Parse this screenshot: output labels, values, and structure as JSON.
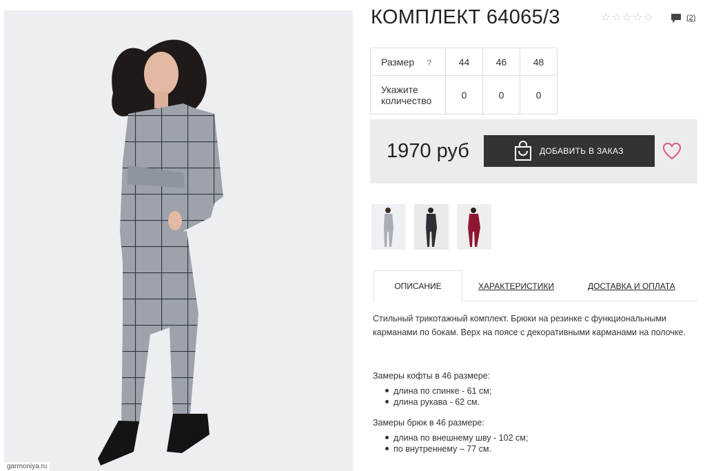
{
  "product": {
    "title": "КОМПЛЕКТ 64065/3",
    "rating_stars": 0,
    "rating_max": 5,
    "comments_count": "(2)",
    "watermark": "garmoniya.ru"
  },
  "size_table": {
    "size_label": "Размер",
    "help_label": "?",
    "qty_label_line1": "Укажите",
    "qty_label_line2": "количество",
    "sizes": [
      "44",
      "46",
      "48"
    ],
    "quantities": [
      "0",
      "0",
      "0"
    ]
  },
  "purchase": {
    "price": "1970 руб",
    "add_button": "ДОБАВИТЬ В ЗАКАЗ",
    "accent_color": "#d65b7c"
  },
  "thumbnails": [
    {
      "name": "grey-check-suit",
      "color": "#a9adb4"
    },
    {
      "name": "dark-check-suit",
      "color": "#2d2f35"
    },
    {
      "name": "burgundy-suit",
      "color": "#8f1631"
    }
  ],
  "tabs": [
    {
      "label": "ОПИСАНИЕ",
      "active": true
    },
    {
      "label": "ХАРАКТЕРИСТИКИ",
      "active": false
    },
    {
      "label": "ДОСТАВКА И ОПЛАТА",
      "active": false
    }
  ],
  "description": {
    "text": "Стильный трикотажный комплект. Брюки на резинке с функциональными карманами по бокам. Верх на поясе с декоративными карманами на полочке.",
    "top_title": "Замеры кофты в 46 размере:",
    "top_items": [
      "длина по спинке - 61 см;",
      "длина рукава - 62 см."
    ],
    "pants_title": "Замеры брюк в 46 размере:",
    "pants_items": [
      "длина по внешнему шву - 102 см;",
      "по внутреннему – 77 см."
    ]
  }
}
